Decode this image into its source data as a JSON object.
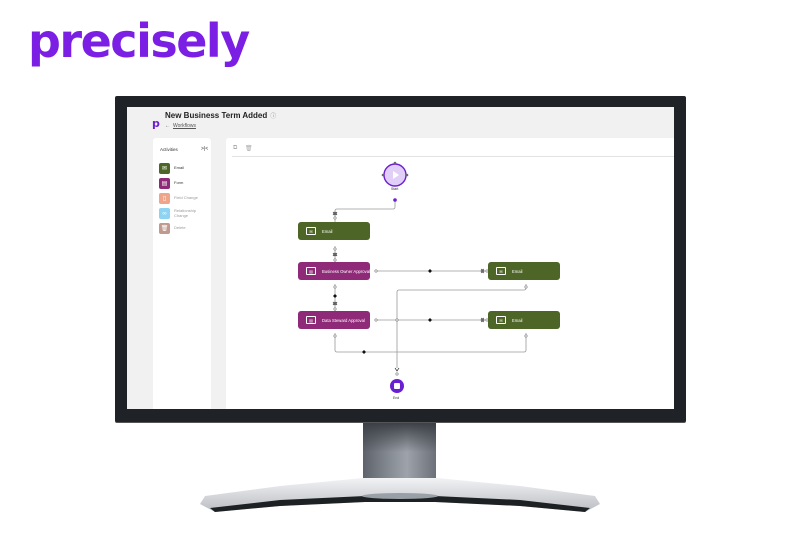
{
  "brand": {
    "logo_text": "precisely",
    "color": "#7b1fe4"
  },
  "app": {
    "brand_icon": "p",
    "title": "New Business Term Added",
    "title_info_icon": "info-circle-icon",
    "breadcrumb_back_icon": "arrow-left-icon",
    "breadcrumb_link": "Workflows"
  },
  "sidebar": {
    "title": "Activities",
    "collapse_icon": "collapse-arrows-icon",
    "items": [
      {
        "label": "Email",
        "icon": "envelope-icon",
        "color": "#4d6526",
        "enabled": true
      },
      {
        "label": "Form",
        "icon": "form-icon",
        "color": "#8e2a78",
        "enabled": true
      },
      {
        "label": "Field Change",
        "icon": "clipboard-icon",
        "color": "#f0a48a",
        "enabled": false
      },
      {
        "label": "Relationship Change",
        "icon": "link-icon",
        "color": "#8fd3f2",
        "enabled": false
      },
      {
        "label": "Delete",
        "icon": "trash-icon",
        "color": "#c09a8f",
        "enabled": false
      }
    ]
  },
  "toolbar": {
    "copy_icon": "copy-icon",
    "delete_icon": "trash-icon"
  },
  "workflow": {
    "start_label": "Start",
    "end_label": "End",
    "nodes": [
      {
        "id": "email1",
        "label": "Email",
        "type": "email",
        "color": "#4d6526"
      },
      {
        "id": "boa",
        "label": "Business Owner Approval",
        "type": "form",
        "color": "#8e2a78"
      },
      {
        "id": "email2",
        "label": "Email",
        "type": "email",
        "color": "#4d6526"
      },
      {
        "id": "dsa",
        "label": "Data Steward Approval",
        "type": "form",
        "color": "#8e2a78"
      },
      {
        "id": "email3",
        "label": "Email",
        "type": "email",
        "color": "#4d6526"
      }
    ],
    "accent": "#6a1fd0"
  }
}
